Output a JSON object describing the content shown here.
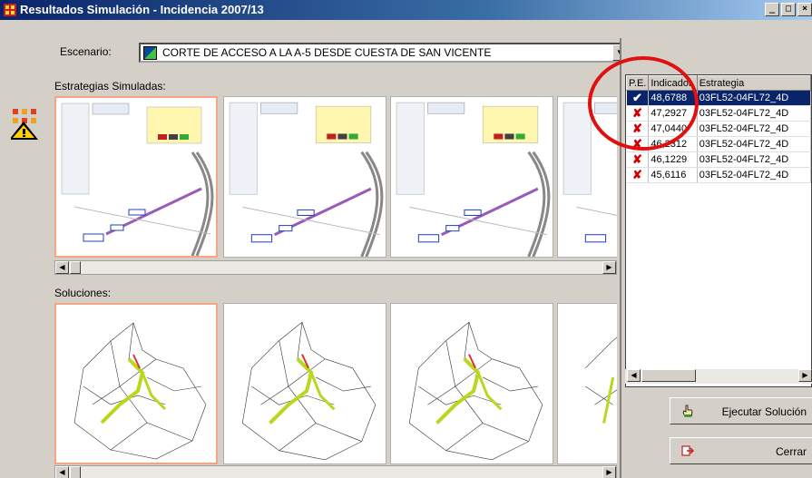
{
  "window": {
    "title": "Resultados Simulación - Incidencia 2007/13",
    "controls": [
      "_",
      "□",
      "×"
    ]
  },
  "escenario": {
    "label": "Escenario:",
    "value": "CORTE DE ACCESO A LA A-5 DESDE CUESTA DE SAN VICENTE"
  },
  "sections": {
    "strategies_label": "Estrategias Simuladas:",
    "solutions_label": "Soluciones:"
  },
  "grid": {
    "columns": [
      "P.E.",
      "Indicador",
      "Estrategia"
    ],
    "rows": [
      {
        "pe": "ok",
        "indicador": "48,6788",
        "estrategia": "03FL52-04FL72_4D",
        "selected": true
      },
      {
        "pe": "no",
        "indicador": "47,2927",
        "estrategia": "03FL52-04FL72_4D",
        "selected": false
      },
      {
        "pe": "no",
        "indicador": "47,0440",
        "estrategia": "03FL52-04FL72_4D",
        "selected": false
      },
      {
        "pe": "no",
        "indicador": "46,2312",
        "estrategia": "03FL52-04FL72_4D",
        "selected": false
      },
      {
        "pe": "no",
        "indicador": "46,1229",
        "estrategia": "03FL52-04FL72_4D",
        "selected": false
      },
      {
        "pe": "no",
        "indicador": "45,6116",
        "estrategia": "03FL52-04FL72_4D",
        "selected": false
      }
    ]
  },
  "buttons": {
    "execute": "Ejecutar Solución",
    "close": "Cerrar"
  },
  "icons": {
    "pe_ok": "green-check-icon",
    "pe_no": "red-x-icon"
  },
  "colors": {
    "title_bar": "#0a246a",
    "selection": "#0a246a",
    "highlight_circle": "#e01010",
    "selected_thumb_border": "#f4a582"
  }
}
